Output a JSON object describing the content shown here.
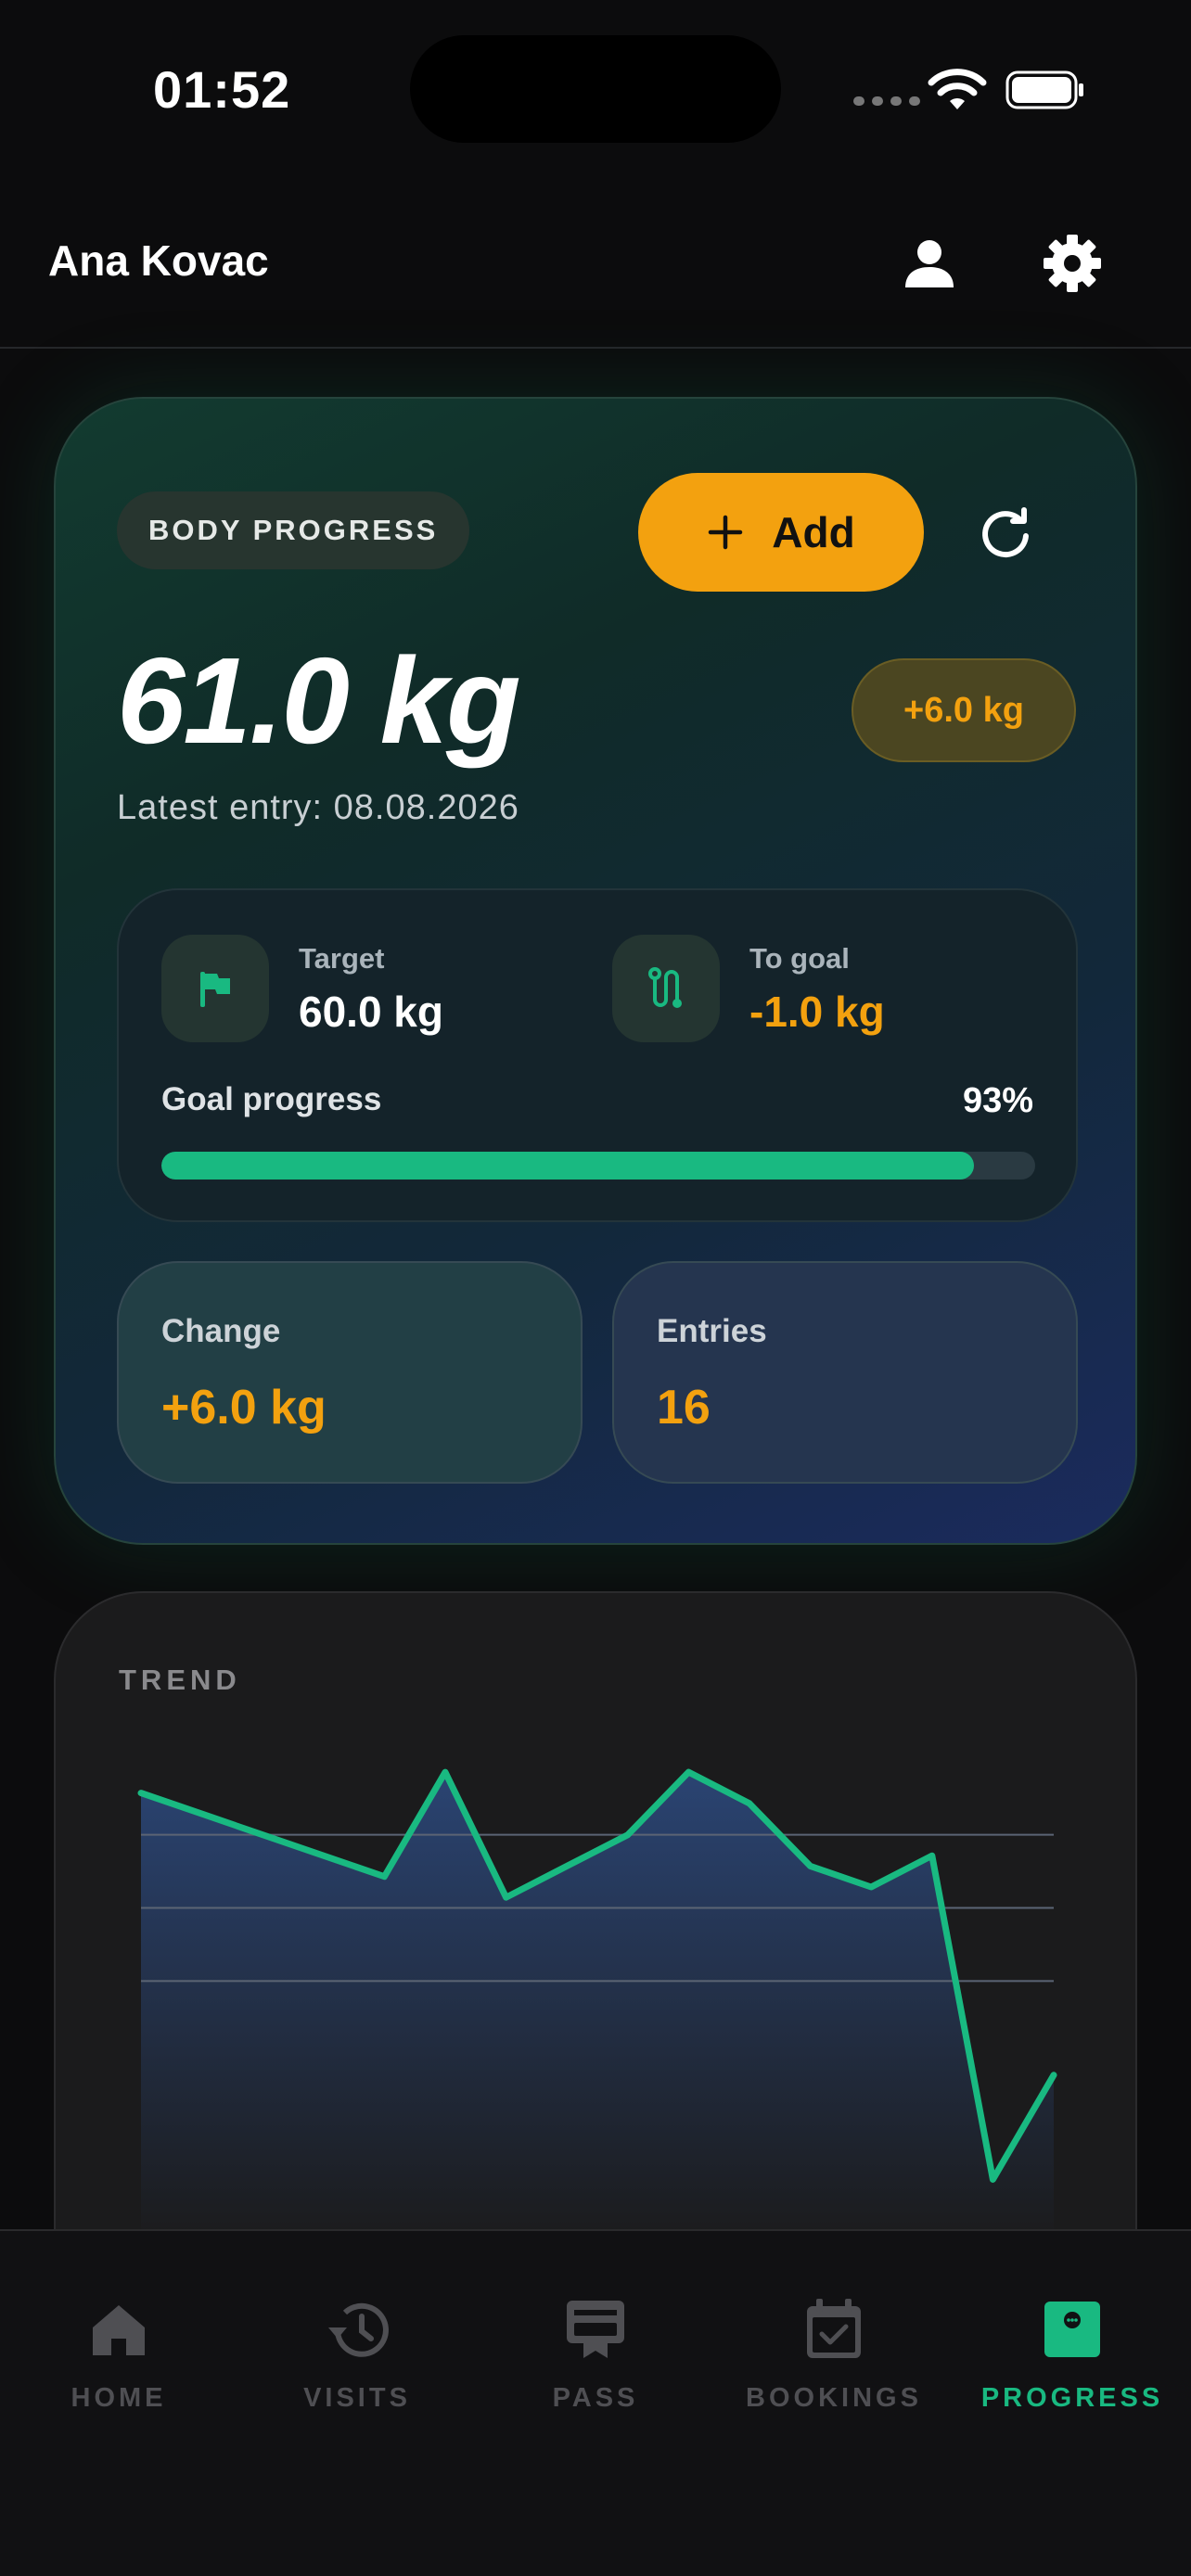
{
  "status_bar": {
    "time": "01:52"
  },
  "header": {
    "user_name": "Ana Kovac",
    "profile_icon": "person-icon",
    "settings_icon": "gear-icon"
  },
  "progress_card": {
    "section_label": "BODY PROGRESS",
    "add_label": "Add",
    "refresh_icon": "refresh-icon",
    "current_weight": "61.0 kg",
    "delta_badge": "+6.0 kg",
    "latest_entry": "Latest entry: 08.08.2026",
    "target": {
      "label": "Target",
      "value": "60.0 kg",
      "icon": "flag-icon"
    },
    "to_goal": {
      "label": "To goal",
      "value": "-1.0 kg",
      "icon": "route-icon"
    },
    "goal_progress": {
      "label": "Goal progress",
      "percent_text": "93%",
      "fraction": 0.93
    },
    "change": {
      "label": "Change",
      "value": "+6.0 kg"
    },
    "entries": {
      "label": "Entries",
      "value": "16"
    }
  },
  "trend": {
    "title": "TREND",
    "chart_data": {
      "type": "area",
      "title": "TREND",
      "values": [
        62.6,
        62.2,
        61.8,
        61.4,
        61.0,
        63.0,
        60.6,
        61.2,
        61.8,
        63.0,
        62.4,
        61.2,
        60.8,
        61.4,
        55.2,
        57.2
      ],
      "grid": true,
      "color_line": "#19b981",
      "color_fill": "#2b4677"
    }
  },
  "nav": {
    "items": [
      {
        "label": "HOME",
        "icon": "home-icon",
        "active": false
      },
      {
        "label": "VISITS",
        "icon": "history-icon",
        "active": false
      },
      {
        "label": "PASS",
        "icon": "pass-icon",
        "active": false
      },
      {
        "label": "BOOKINGS",
        "icon": "calendar-check-icon",
        "active": false
      },
      {
        "label": "PROGRESS",
        "icon": "progress-icon",
        "active": true
      }
    ]
  },
  "colors": {
    "accent": "#f3a10f",
    "success": "#19b981",
    "background": "#0c0c0d"
  }
}
